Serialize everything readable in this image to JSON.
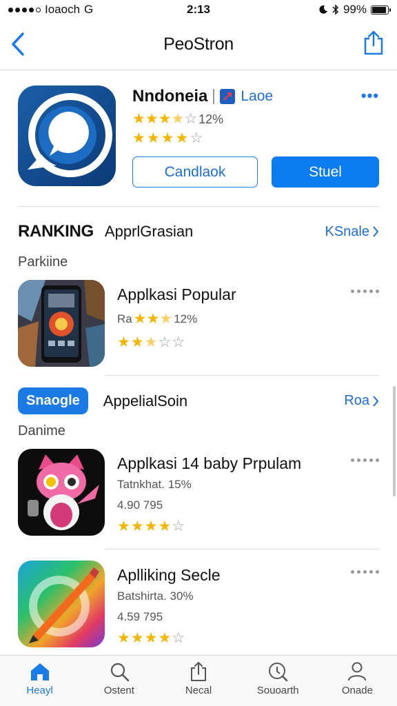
{
  "status_bar": {
    "carrier": "Ioaoch",
    "network": "G",
    "time": "2:13",
    "battery_percent": "99%",
    "battery_level": 0.9
  },
  "navbar": {
    "title": "PeoStron"
  },
  "featured": {
    "name": "Nndoneia",
    "tag": "Laoe",
    "rating_text": "12%",
    "stars_primary": 3.5,
    "stars_secondary": 4,
    "button_outline_label": "Candlaok",
    "button_solid_label": "Stuel"
  },
  "section_ranking": {
    "title": "RANKING",
    "subtitle": "ApprlGrasian",
    "link_label": "KSnale",
    "caption": "Parkiine"
  },
  "section_second": {
    "pill_label": "Snaogle",
    "subtitle": "AppelialSoin",
    "link_label": "Roa",
    "caption": "Danime"
  },
  "apps": [
    {
      "name": "Applkasi Popular",
      "meta_prefix": "Ra",
      "meta_stars": 2.5,
      "meta_suffix": "12%",
      "line2": "",
      "stars": 2.5
    },
    {
      "name": "Applkasi 14 baby Prpulam",
      "meta_prefix": "Tatnkhat. 15%",
      "meta_stars": 0,
      "meta_suffix": "",
      "line2": "4.90 795",
      "stars": 4
    },
    {
      "name": "Aplliking Secle",
      "meta_prefix": "Batshirta. 30%",
      "meta_stars": 0,
      "meta_suffix": "",
      "line2": "4.59 795",
      "stars": 4
    }
  ],
  "tabs": [
    {
      "label": "Heayl",
      "icon": "home-icon",
      "active": true
    },
    {
      "label": "Ostent",
      "icon": "search-icon",
      "active": false
    },
    {
      "label": "Necal",
      "icon": "share-box-icon",
      "active": false
    },
    {
      "label": "Souoarth",
      "icon": "magnifier-icon",
      "active": false
    },
    {
      "label": "Onade",
      "icon": "person-icon",
      "active": false
    }
  ],
  "colors": {
    "accent": "#0a7cf0",
    "star": "#f4b400",
    "divider": "#dcdcdc"
  }
}
